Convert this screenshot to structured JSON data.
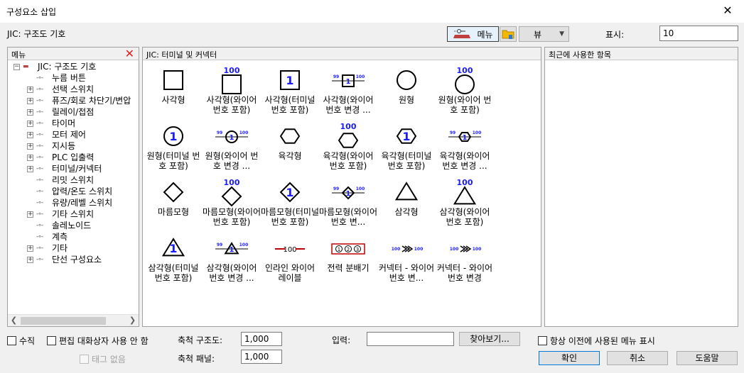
{
  "window": {
    "title": "구성요소 삽입",
    "subtitle": "JIC: 구조도 기호"
  },
  "toolbar": {
    "menu_label": "메뉴",
    "view_label": "뷰",
    "show_label": "표시:",
    "show_value": "10"
  },
  "left_panel": {
    "header": "메뉴",
    "root": "JIC: 구조도 기호",
    "items": [
      {
        "label": "누름 버튼",
        "expandable": false
      },
      {
        "label": "선택 스위치",
        "expandable": true
      },
      {
        "label": "퓨즈/회로 차단기/변압",
        "expandable": true
      },
      {
        "label": "릴레이/접점",
        "expandable": true
      },
      {
        "label": "타이머",
        "expandable": true
      },
      {
        "label": "모터 제어",
        "expandable": true
      },
      {
        "label": "지시등",
        "expandable": true
      },
      {
        "label": "PLC 입출력",
        "expandable": true
      },
      {
        "label": "터미널/커넥터",
        "expandable": true
      },
      {
        "label": "리밋 스위치",
        "expandable": false
      },
      {
        "label": "압력/온도 스위치",
        "expandable": false
      },
      {
        "label": "유량/레벨 스위치",
        "expandable": false
      },
      {
        "label": "기타 스위치",
        "expandable": true
      },
      {
        "label": "솔레노이드",
        "expandable": false
      },
      {
        "label": "계측",
        "expandable": false
      },
      {
        "label": "기타",
        "expandable": true
      },
      {
        "label": "단선 구성요소",
        "expandable": true
      }
    ]
  },
  "mid_panel": {
    "header": "JIC: 터미널 및 커넥터",
    "symbols": [
      {
        "label": "사각형",
        "shape": "square",
        "tag": ""
      },
      {
        "label": "사각형(와이어 번호 포함)",
        "shape": "square",
        "tag": "100"
      },
      {
        "label": "사각형(터미널 번호 포함)",
        "shape": "square-num",
        "tag": ""
      },
      {
        "label": "사각형(와이어 번호 변경 ...",
        "shape": "square-change",
        "tag": ""
      },
      {
        "label": "원형",
        "shape": "circle",
        "tag": ""
      },
      {
        "label": "원형(와이어 번호 포함)",
        "shape": "circle",
        "tag": "100"
      },
      {
        "label": "원형(터미널 번호 포함)",
        "shape": "circle-num",
        "tag": ""
      },
      {
        "label": "원형(와이어 번호 변경 ...",
        "shape": "circle-change",
        "tag": ""
      },
      {
        "label": "육각형",
        "shape": "hexagon",
        "tag": ""
      },
      {
        "label": "육각형(와이어 번호 포함)",
        "shape": "hexagon",
        "tag": "100"
      },
      {
        "label": "육각형(터미널 번호 포함)",
        "shape": "hexagon-num",
        "tag": ""
      },
      {
        "label": "육각형(와이어 번호 변경 ...",
        "shape": "hexagon-change",
        "tag": ""
      },
      {
        "label": "마름모형",
        "shape": "diamond",
        "tag": ""
      },
      {
        "label": "마름모형(와이어 번호 포함)",
        "shape": "diamond",
        "tag": "100"
      },
      {
        "label": "마름모형(터미널 번호 포함)",
        "shape": "diamond-num",
        "tag": ""
      },
      {
        "label": "마름모형(와이어 번호 변...",
        "shape": "diamond-change",
        "tag": ""
      },
      {
        "label": "삼각형",
        "shape": "triangle",
        "tag": ""
      },
      {
        "label": "삼각형(와이어 번호 포함)",
        "shape": "triangle",
        "tag": "100"
      },
      {
        "label": "삼각형(터미널 번호 포함)",
        "shape": "triangle-num",
        "tag": ""
      },
      {
        "label": "삼각형(와이어 번호 변경 ...",
        "shape": "triangle-change",
        "tag": ""
      },
      {
        "label": "인라인 와이어 레이블",
        "shape": "inline",
        "tag": ""
      },
      {
        "label": "전력 분배기",
        "shape": "distributor",
        "tag": ""
      },
      {
        "label": "커넥터 - 와이어 번호 변...",
        "shape": "connector-change",
        "tag": ""
      },
      {
        "label": "커넥터 - 와이어 번호 변경",
        "shape": "connector",
        "tag": ""
      }
    ],
    "glyphs": {
      "num": "1",
      "tag": "100",
      "from": "99",
      "to": "100",
      "dist": [
        "1",
        "2",
        "3"
      ]
    }
  },
  "right_panel": {
    "header": "최근에 사용한 항목"
  },
  "bottom": {
    "vertical": "수직",
    "no_edit_dialog": "편집 대화상자 사용 안 함",
    "no_tag": "태그 없음",
    "scale_schematic_label": "축척 구조도:",
    "scale_schematic_value": "1,000",
    "scale_panel_label": "축척 패널:",
    "scale_panel_value": "1,000",
    "input_label": "입력:",
    "input_value": "",
    "browse": "찾아보기...",
    "always_show": "항상 이전에 사용된 메뉴 표시",
    "ok": "확인",
    "cancel": "취소",
    "help": "도움말"
  },
  "colors": {
    "accent": "#0078d7",
    "symbol_blue": "#1a1aff",
    "close_red": "#e02020",
    "line_red": "#c00000"
  }
}
